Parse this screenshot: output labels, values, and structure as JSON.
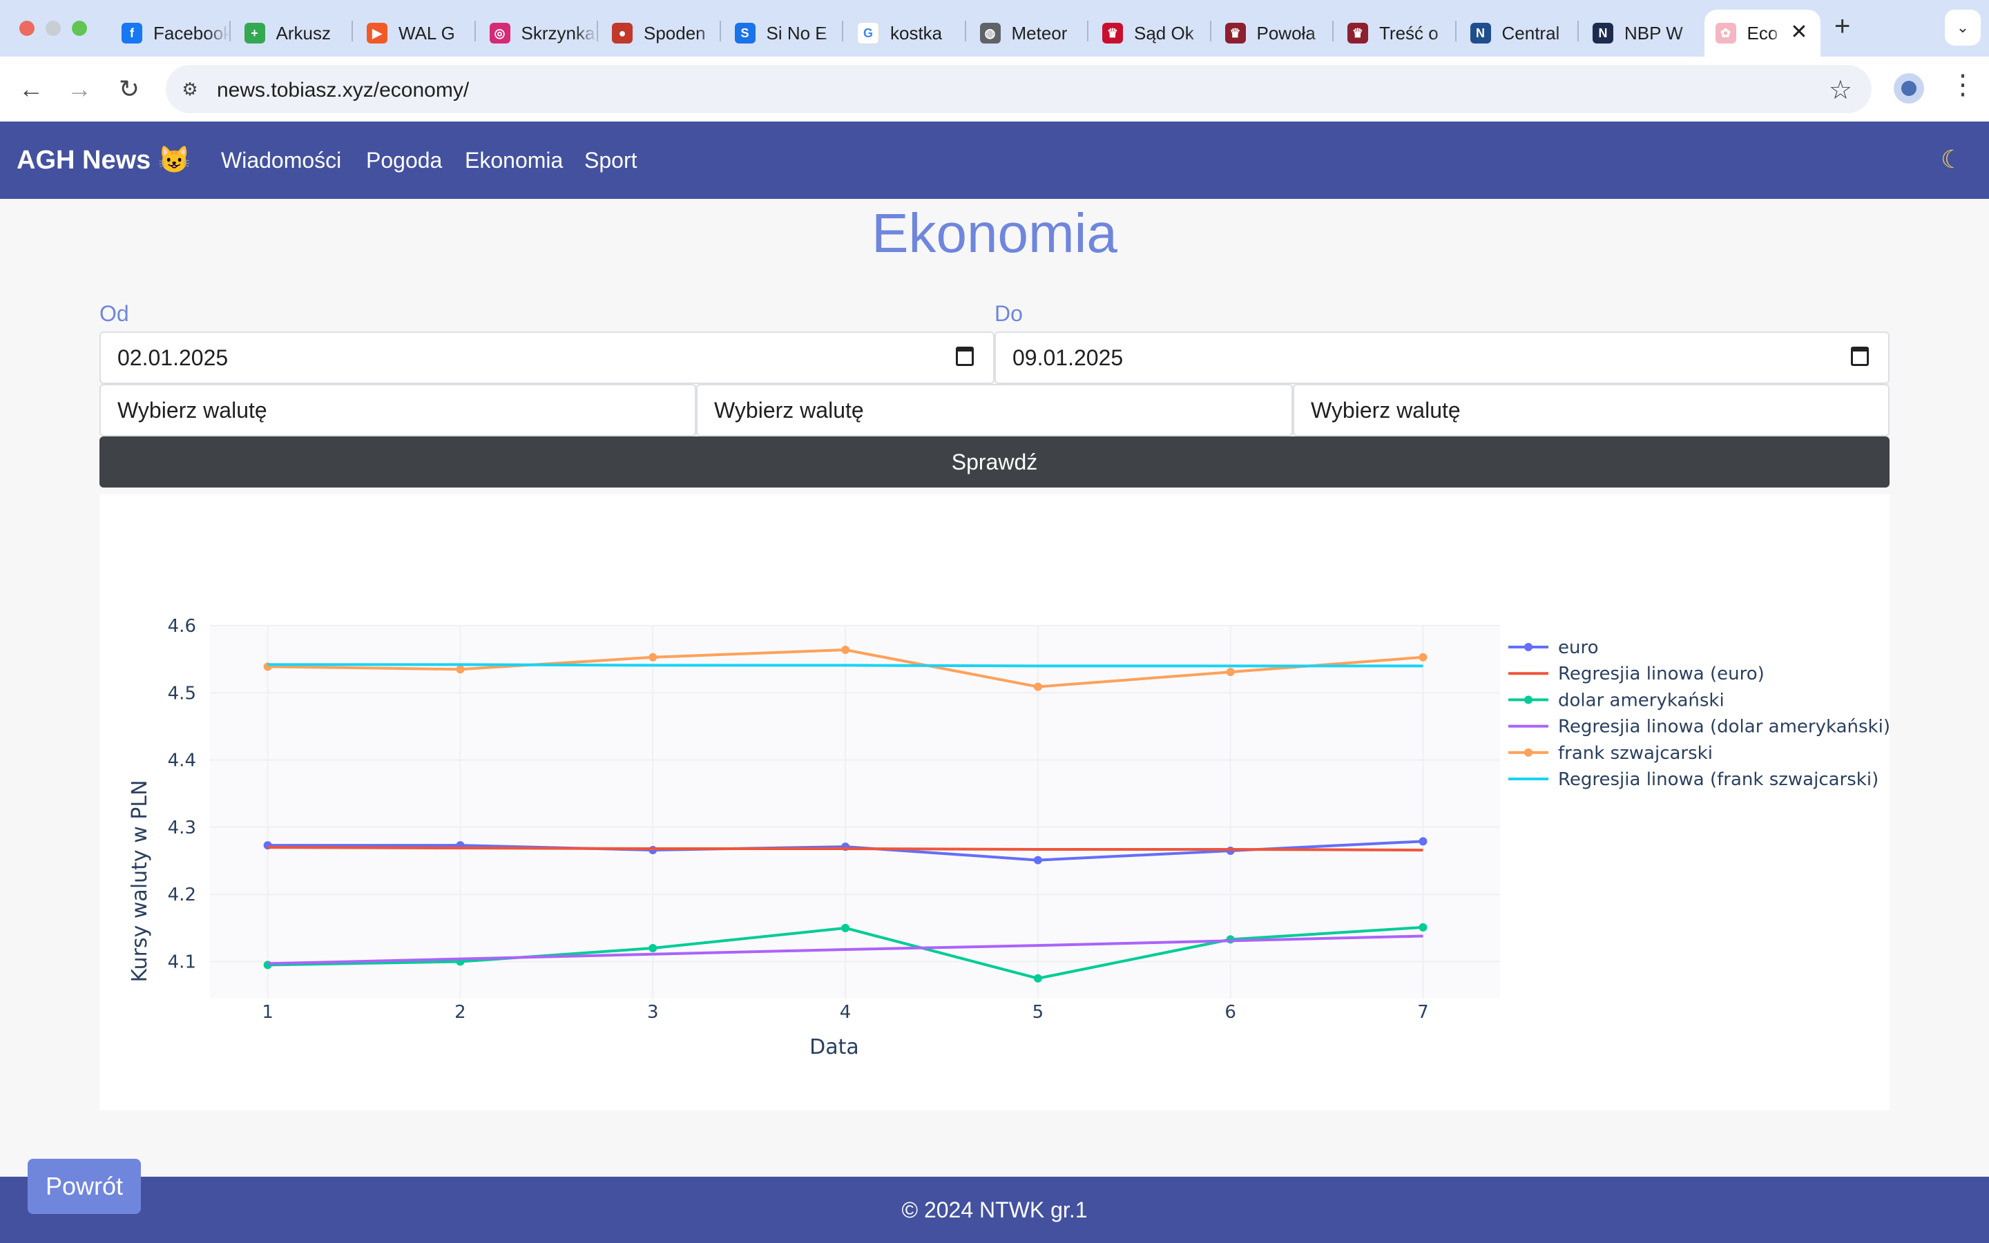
{
  "browser": {
    "tabs": [
      {
        "title": "Facebook",
        "icon": "facebook-icon",
        "color": "#1877f2",
        "glyph": "f"
      },
      {
        "title": "Arkusz",
        "icon": "sheets-icon",
        "color": "#34a853",
        "glyph": "+"
      },
      {
        "title": "WAL G",
        "icon": "play-icon",
        "color": "#f05a28",
        "glyph": "▶"
      },
      {
        "title": "Skrzynka",
        "icon": "instagram-icon",
        "color": "#d62976",
        "glyph": "◎"
      },
      {
        "title": "Spoden",
        "icon": "ball-icon",
        "color": "#c0392b",
        "glyph": "●"
      },
      {
        "title": "Si No E",
        "icon": "shazam-icon",
        "color": "#1a73e8",
        "glyph": "S"
      },
      {
        "title": "kostka",
        "icon": "google-icon",
        "color": "#ffffff",
        "glyph": "G"
      },
      {
        "title": "Meteor",
        "icon": "globe-icon",
        "color": "#5f6368",
        "glyph": "◍"
      },
      {
        "title": "Sąd Ok",
        "icon": "eagle-icon",
        "color": "#c8102e",
        "glyph": "♛"
      },
      {
        "title": "Powoła",
        "icon": "eagle-icon",
        "color": "#8e1f2f",
        "glyph": "♛"
      },
      {
        "title": "Treść o",
        "icon": "eagle-icon",
        "color": "#8e1f2f",
        "glyph": "♛"
      },
      {
        "title": "Central",
        "icon": "nsa-icon",
        "color": "#1f4e8c",
        "glyph": "N"
      },
      {
        "title": "NBP W",
        "icon": "nbp-icon",
        "color": "#1d2b4f",
        "glyph": "N"
      },
      {
        "title": "Eco",
        "icon": "cat-icon",
        "color": "#f4b6c2",
        "glyph": "✿"
      }
    ],
    "url": "news.tobiasz.xyz/economy/"
  },
  "site": {
    "brand": "AGH News 😺",
    "nav": [
      "Wiadomości",
      "Pogoda",
      "Ekonomia",
      "Sport"
    ],
    "theme_icon": "moon-icon"
  },
  "page": {
    "title": "Ekonomia",
    "from_label": "Od",
    "to_label": "Do",
    "from_value": "02.01.2025",
    "to_value": "09.01.2025",
    "currency_selects": [
      "Wybierz walutę",
      "Wybierz walutę",
      "Wybierz walutę"
    ],
    "check_button": "Sprawdź"
  },
  "chart_data": {
    "type": "line",
    "xlabel": "Data",
    "ylabel": "Kursy waluty w PLN",
    "xlim": [
      0.7,
      7.4
    ],
    "ylim": [
      4.045,
      4.6
    ],
    "yticks": [
      4.1,
      4.2,
      4.3,
      4.4,
      4.5,
      4.6
    ],
    "x": [
      1,
      2,
      3,
      4,
      5,
      6,
      7
    ],
    "grid": true,
    "legend_position": "right",
    "series": [
      {
        "name": "euro",
        "color": "#636efa",
        "markers": true,
        "values": [
          4.273,
          4.273,
          4.266,
          4.271,
          4.251,
          4.265,
          4.279
        ]
      },
      {
        "name": "Regresjia linowa (euro)",
        "color": "#ef553b",
        "markers": false,
        "values": [
          4.27,
          4.269,
          4.268,
          4.268,
          4.267,
          4.267,
          4.266
        ]
      },
      {
        "name": "dolar amerykański",
        "color": "#00cc96",
        "markers": true,
        "values": [
          4.095,
          4.1,
          4.12,
          4.15,
          4.075,
          4.133,
          4.151
        ]
      },
      {
        "name": "Regresjia linowa (dolar amerykański)",
        "color": "#ab63fa",
        "markers": false,
        "values": [
          4.097,
          4.104,
          4.111,
          4.118,
          4.124,
          4.131,
          4.138
        ]
      },
      {
        "name": "frank szwajcarski",
        "color": "#ffa15a",
        "markers": true,
        "values": [
          4.539,
          4.535,
          4.553,
          4.564,
          4.509,
          4.531,
          4.553
        ]
      },
      {
        "name": "Regresjia linowa (frank szwajcarski)",
        "color": "#19d3f3",
        "markers": false,
        "values": [
          4.542,
          4.542,
          4.541,
          4.541,
          4.54,
          4.54,
          4.54
        ]
      }
    ]
  },
  "footer": {
    "text": "© 2024 NTWK gr.1",
    "back_button": "Powrót"
  }
}
